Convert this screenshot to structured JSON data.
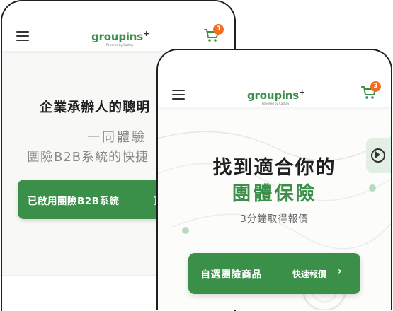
{
  "brand": {
    "logo_text": "groupins",
    "logo_plus": "+",
    "logo_tagline": "Powered by Cathay",
    "green": "#3a8f49",
    "accent_orange": "#f26d21"
  },
  "cart": {
    "badge_count": "3"
  },
  "back_screen": {
    "headline": "企業承辦人的聰明",
    "sub_line1": "一同體驗",
    "sub_line2": "團險B2B系統的快捷",
    "button_label": "已啟用團險B2B系統",
    "button_label_2": "直"
  },
  "front_screen": {
    "headline_1": "找到適合你的",
    "headline_2": "團體保險",
    "subtitle": "3分鐘取得報價",
    "button_label": "自選團險商品",
    "button_secondary": "快速報價",
    "button_chevron": "›"
  },
  "icons": [
    "menu-icon",
    "cart-icon",
    "play-icon"
  ]
}
